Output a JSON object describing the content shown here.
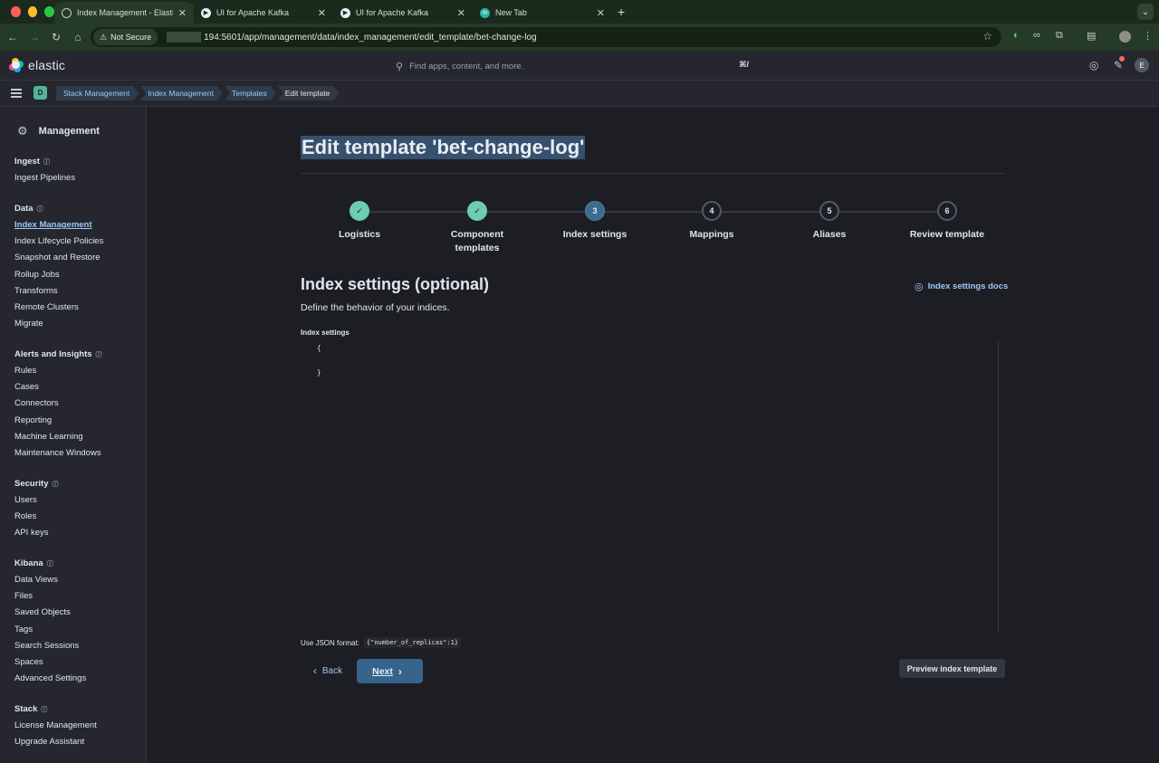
{
  "browser": {
    "tabs": [
      {
        "title": "Index Management - Elastic",
        "active": true
      },
      {
        "title": "UI for Apache Kafka",
        "active": false
      },
      {
        "title": "UI for Apache Kafka",
        "active": false
      },
      {
        "title": "New Tab",
        "active": false
      }
    ],
    "new_tab": "+",
    "not_secure": "Not Secure",
    "url": "194:5601/app/management/data/index_management/edit_template/bet-change-log"
  },
  "header": {
    "logo_text": "elastic",
    "search_placeholder": "Find apps, content, and more.",
    "search_shortcut": "⌘/",
    "avatar_initial": "E"
  },
  "breadcrumbs": {
    "space_initial": "D",
    "items": [
      "Stack Management",
      "Index Management",
      "Templates",
      "Edit template"
    ]
  },
  "sidebar": {
    "title": "Management",
    "groups": [
      {
        "title": "Ingest",
        "items": [
          "Ingest Pipelines"
        ]
      },
      {
        "title": "Data",
        "items": [
          "Index Management",
          "Index Lifecycle Policies",
          "Snapshot and Restore",
          "Rollup Jobs",
          "Transforms",
          "Remote Clusters",
          "Migrate"
        ]
      },
      {
        "title": "Alerts and Insights",
        "items": [
          "Rules",
          "Cases",
          "Connectors",
          "Reporting",
          "Machine Learning",
          "Maintenance Windows"
        ]
      },
      {
        "title": "Security",
        "items": [
          "Users",
          "Roles",
          "API keys"
        ]
      },
      {
        "title": "Kibana",
        "items": [
          "Data Views",
          "Files",
          "Saved Objects",
          "Tags",
          "Search Sessions",
          "Spaces",
          "Advanced Settings"
        ]
      },
      {
        "title": "Stack",
        "items": [
          "License Management",
          "Upgrade Assistant"
        ]
      }
    ],
    "selected": "Index Management"
  },
  "page": {
    "title": "Edit template 'bet-change-log'",
    "steps": [
      {
        "num": "1",
        "label": "Logistics",
        "state": "done"
      },
      {
        "num": "2",
        "label": "Component templates",
        "state": "done"
      },
      {
        "num": "3",
        "label": "Index settings",
        "state": "current"
      },
      {
        "num": "4",
        "label": "Mappings",
        "state": "todo"
      },
      {
        "num": "5",
        "label": "Aliases",
        "state": "todo"
      },
      {
        "num": "6",
        "label": "Review template",
        "state": "todo"
      }
    ],
    "section_title": "Index settings (optional)",
    "section_desc": "Define the behavior of your indices.",
    "docs_link": "Index settings docs",
    "editor_label": "Index settings",
    "editor_content": "{\n\n}",
    "hint_text": "Use JSON format:",
    "hint_code": "{\"number_of_replicas\":1}",
    "back_label": "Back",
    "next_label": "Next",
    "preview_label": "Preview index template"
  },
  "colors": {
    "accent": "#9ec7f4",
    "done_step": "#6dccb1",
    "current_step": "#3c6b8e",
    "primary_button": "#36648c"
  }
}
